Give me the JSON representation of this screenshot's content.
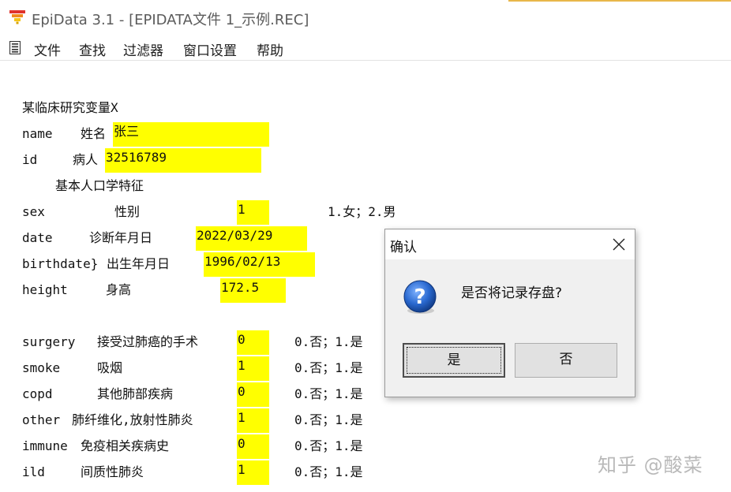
{
  "window": {
    "title": "EpiData 3.1 - [EPIDATA文件 1_示例.REC]"
  },
  "menu": {
    "items": [
      "文件",
      "查找",
      "过滤器",
      "窗口设置",
      "帮助"
    ]
  },
  "form": {
    "heading": "某临床研究变量X",
    "section_basic": "基本人口学特征",
    "rows": [
      {
        "var": "name",
        "label": "姓名",
        "value": "张三",
        "hint": ""
      },
      {
        "var": "id",
        "label": "病人",
        "value": "32516789",
        "hint": ""
      },
      {
        "var": "sex",
        "label": "性别",
        "value": "1",
        "hint": "1.女；2.男"
      },
      {
        "var": "date",
        "label": "诊断年月日",
        "value": "2022/03/29",
        "hint": ""
      },
      {
        "var": "birthdate}",
        "label": "出生年月日",
        "value": "1996/02/13",
        "hint": ""
      },
      {
        "var": "height",
        "label": "身高",
        "value": "172.5",
        "hint": ""
      },
      {
        "var": "surgery",
        "label": "接受过肺癌的手术",
        "value": "0",
        "hint": "0.否；1.是"
      },
      {
        "var": "smoke",
        "label": "吸烟",
        "value": "1",
        "hint": "0.否；1.是"
      },
      {
        "var": "copd",
        "label": "其他肺部疾病",
        "value": "0",
        "hint": "0.否；1.是"
      },
      {
        "var": "other",
        "label": "肺纤维化,放射性肺炎",
        "value": "1",
        "hint": "0.否；1.是"
      },
      {
        "var": "immune",
        "label": "免疫相关疾病史",
        "value": "0",
        "hint": "0.否；1.是"
      },
      {
        "var": "ild",
        "label": "间质性肺炎",
        "value": "1",
        "hint": "0.否；1.是"
      }
    ]
  },
  "dialog": {
    "title": "确认",
    "message": "是否将记录存盘?",
    "yes_label": "是",
    "no_label": "否",
    "icon": "question-icon"
  },
  "watermark": "知乎 @酸菜",
  "colors": {
    "field_bg": "#ffff00",
    "dialog_bg": "#f0f0f0",
    "question_blue": "#1f5fbf"
  }
}
